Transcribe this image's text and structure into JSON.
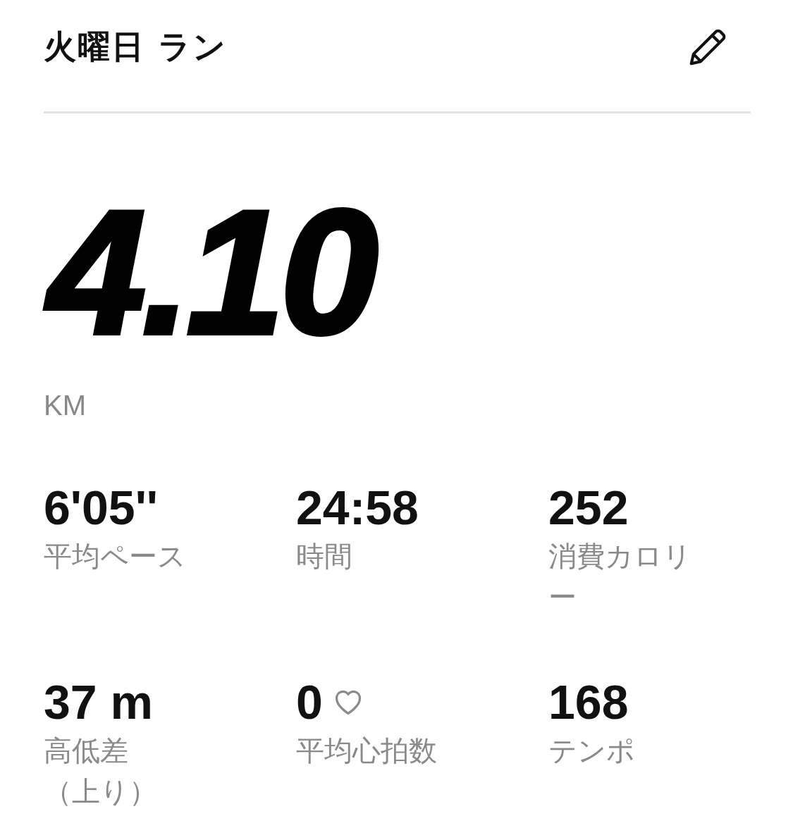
{
  "header": {
    "title": "火曜日 ラン"
  },
  "distance": {
    "value": "4.10",
    "unit": "KM"
  },
  "stats": [
    {
      "kind": "plain",
      "value": "6'05''",
      "label": "平均ペース"
    },
    {
      "kind": "plain",
      "value": "24:58",
      "label": "時間"
    },
    {
      "kind": "plain",
      "value": "252",
      "label": "消費カロリー"
    },
    {
      "kind": "plain",
      "value": "37 m",
      "label": "高低差",
      "label_continued": "（上り）"
    },
    {
      "kind": "heart_rate",
      "value": "0",
      "label": "平均心拍数"
    },
    {
      "kind": "plain",
      "value": "168",
      "label": "テンポ"
    }
  ]
}
